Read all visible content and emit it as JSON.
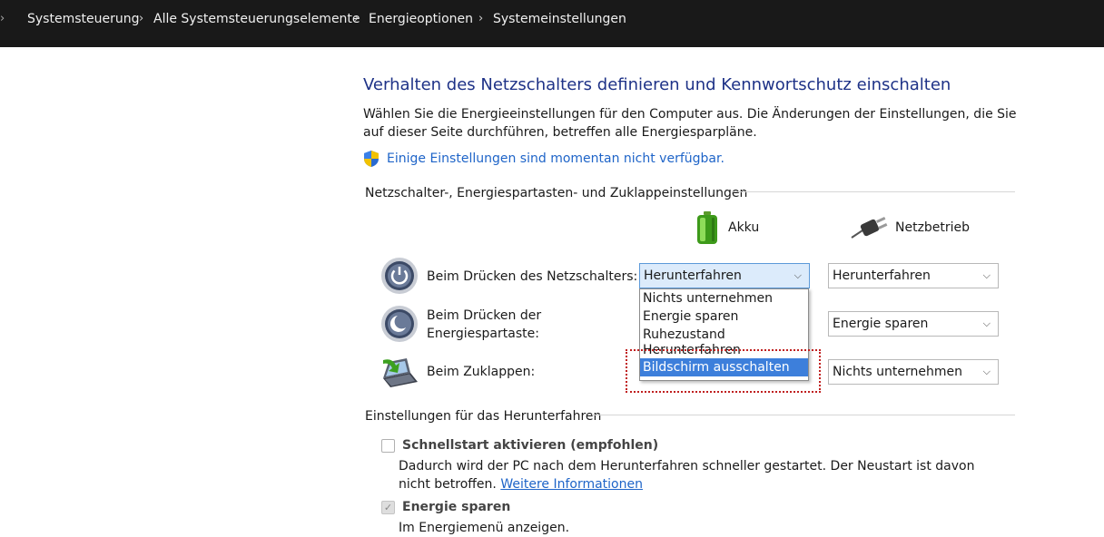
{
  "breadcrumb": {
    "items": [
      "Systemsteuerung",
      "Alle Systemsteuerungselemente",
      "Energieoptionen",
      "Systemeinstellungen"
    ],
    "separator": "›"
  },
  "page": {
    "title": "Verhalten des Netzschalters definieren und Kennwortschutz einschalten",
    "description": "Wählen Sie die Energieeinstellungen für den Computer aus. Die Änderungen der Einstellungen, die Sie auf dieser Seite durchführen, betreffen alle Energiesparpläne.",
    "admin_link": "Einige Einstellungen sind momentan nicht verfügbar."
  },
  "buttons_section": {
    "heading": "Netzschalter-, Energiespartasten- und Zuklappeinstellungen",
    "columns": {
      "battery": "Akku",
      "plugged_in": "Netzbetrieb"
    },
    "rows": [
      {
        "label": "Beim Drücken des Netzschalters:",
        "battery": "Herunterfahren",
        "plugged_in": "Herunterfahren"
      },
      {
        "label": "Beim Drücken der Energiespartaste:",
        "battery": "Energie sparen",
        "plugged_in": "Energie sparen"
      },
      {
        "label": "Beim Zuklappen:",
        "battery": "Bildschirm ausschalten",
        "plugged_in": "Nichts unternehmen"
      }
    ],
    "dropdown_options": [
      "Nichts unternehmen",
      "Energie sparen",
      "Ruhezustand",
      "Herunterfahren",
      "Bildschirm ausschalten"
    ],
    "dropdown_highlighted": "Bildschirm ausschalten"
  },
  "shutdown_section": {
    "heading": "Einstellungen für das Herunterfahren",
    "fast_startup": {
      "label": "Schnellstart aktivieren (empfohlen)",
      "checked": false,
      "description": "Dadurch wird der PC nach dem Herunterfahren schneller gestartet. Der Neustart ist davon nicht betroffen.",
      "more_link": "Weitere Informationen"
    },
    "sleep": {
      "label": "Energie sparen",
      "checked": true,
      "description": "Im Energiemenü anzeigen."
    }
  },
  "colors": {
    "titlebar_bg": "#191919",
    "title_blue": "#1e3287",
    "link_blue": "#1e64c8",
    "highlight": "#3d7fdb",
    "annotation_red": "#c02020"
  }
}
